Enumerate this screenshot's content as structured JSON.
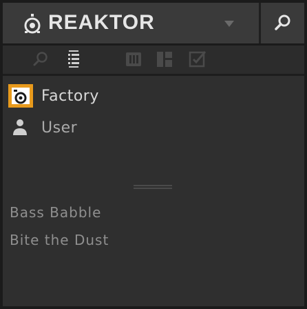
{
  "header": {
    "product_name": "REAKTOR",
    "logo_icon": "reaktor-logo-icon",
    "dropdown_icon": "chevron-down-icon",
    "search_icon": "search-icon"
  },
  "toolbar": {
    "icons": [
      "search-icon",
      "list-view-icon",
      "instrument-icon",
      "tiles-icon",
      "checkbox-icon"
    ]
  },
  "libraries": [
    {
      "label": "Factory",
      "icon": "factory-library-icon",
      "selected": true
    },
    {
      "label": "User",
      "icon": "user-icon",
      "selected": false
    }
  ],
  "results": [
    "Bass Babble",
    "Bite the Dust"
  ],
  "colors": {
    "background": "#2f2f2f",
    "header": "#3a3a3a",
    "accent": "#e89a1c",
    "text": "#d8d8d8"
  }
}
